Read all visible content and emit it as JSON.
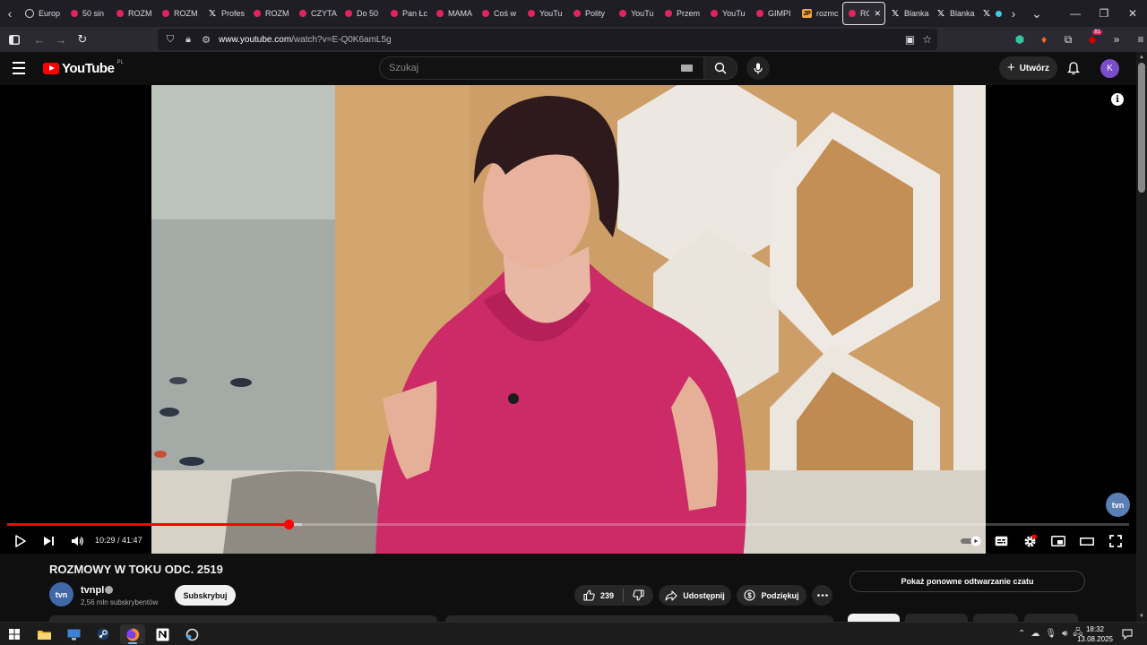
{
  "browser": {
    "tabs": [
      {
        "label": "Europ",
        "icon": "globe"
      },
      {
        "label": "50 sin",
        "icon": "yt"
      },
      {
        "label": "ROZM",
        "icon": "yt"
      },
      {
        "label": "ROZM",
        "icon": "yt"
      },
      {
        "label": "Profes",
        "icon": "x"
      },
      {
        "label": "ROZM",
        "icon": "yt"
      },
      {
        "label": "CZYTA",
        "icon": "yt"
      },
      {
        "label": "Do 50",
        "icon": "yt"
      },
      {
        "label": "Pan Łc",
        "icon": "yt"
      },
      {
        "label": "MAMA",
        "icon": "yt"
      },
      {
        "label": "Coś w",
        "icon": "yt"
      },
      {
        "label": "YouTu",
        "icon": "yt"
      },
      {
        "label": "Polity",
        "icon": "yt"
      },
      {
        "label": "YouTu",
        "icon": "yt"
      },
      {
        "label": "Przem",
        "icon": "yt"
      },
      {
        "label": "YouTu",
        "icon": "yt"
      },
      {
        "label": "GIMPI",
        "icon": "yt"
      },
      {
        "label": "rozmc",
        "icon": "jp"
      },
      {
        "label": "RO",
        "icon": "yt",
        "active": true
      },
      {
        "label": "Blanka",
        "icon": "x"
      },
      {
        "label": "Blanka",
        "icon": "x"
      }
    ],
    "url_host": "www.youtube.com",
    "url_path": "/watch?v=E-Q0K6amL5g",
    "extension_badge": "81"
  },
  "youtube": {
    "logo_text": "YouTube",
    "country_code": "PL",
    "search_placeholder": "Szukaj",
    "create_label": "Utwórz",
    "avatar_letter": "K"
  },
  "player": {
    "current_time": "10:29",
    "duration": "41:47",
    "played_fraction": 0.251,
    "buffered_fraction": 0.263,
    "info_glyph": "i",
    "channel_bug": "tvn"
  },
  "video": {
    "title": "ROZMOWY W TOKU ODC. 2519",
    "channel_name": "tvnpl",
    "channel_avatar_text": "tvn",
    "subscriber_count": "2,56 mln subskrybentów",
    "subscribe_label": "Subskrybuj",
    "like_count": "239",
    "share_label": "Udostępnij",
    "thanks_label": "Podziękuj",
    "chat_replay_label": "Pokaż ponowne odtwarzanie czatu"
  },
  "taskbar": {
    "time": "18:32",
    "date": "13.08.2025"
  },
  "colors": {
    "accent_red": "#ff0000",
    "background": "#0f0f0f",
    "avatar": "#7b4dc9"
  }
}
